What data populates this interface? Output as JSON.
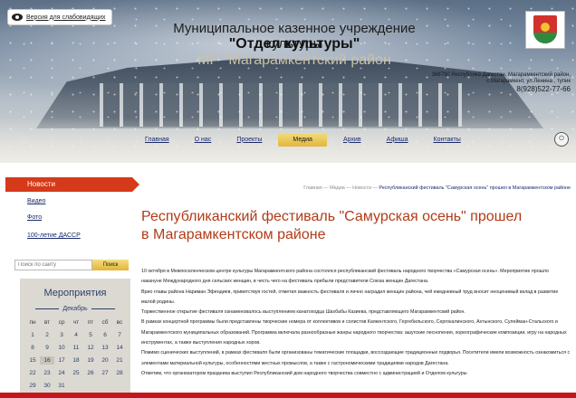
{
  "header": {
    "vi_link": "Версия для слабовидящих",
    "title_line1": "Муниципальное казенное учреждение культуры",
    "title_line2": "\"Отдел культуры\"",
    "title_line3": "МР \"Магарамкентский район",
    "address": "368780 Республика Дагестан, Магарамкентский район, с.Магарамкент, ул.Ленина , тупик",
    "phone": "8(928)522-77-66"
  },
  "nav": {
    "items": [
      {
        "label": "Главная",
        "active": false
      },
      {
        "label": "О нас",
        "active": false
      },
      {
        "label": "Проекты",
        "active": false
      },
      {
        "label": "Медиа",
        "active": true
      },
      {
        "label": "Архив",
        "active": false
      },
      {
        "label": "Афиша",
        "active": false
      },
      {
        "label": "Контакты",
        "active": false
      }
    ]
  },
  "sidebar": {
    "active_item": "Новости",
    "items": [
      "Видео",
      "Фото",
      "100-летие ДАССР"
    ]
  },
  "search": {
    "placeholder": "Поиск по сайту",
    "button": "Поиск"
  },
  "events": {
    "title": "Мероприятия",
    "month": "Декабрь",
    "weekdays": [
      "пн",
      "вт",
      "ср",
      "чт",
      "пт",
      "сб",
      "вс"
    ],
    "weeks": [
      [
        "1",
        "2",
        "3",
        "4",
        "5",
        "6",
        "7"
      ],
      [
        "8",
        "9",
        "10",
        "11",
        "12",
        "13",
        "14"
      ],
      [
        "15",
        "16",
        "17",
        "18",
        "19",
        "20",
        "21"
      ],
      [
        "22",
        "23",
        "24",
        "25",
        "26",
        "27",
        "28"
      ],
      [
        "29",
        "30",
        "31",
        "",
        "",
        "",
        ""
      ]
    ],
    "today": "16"
  },
  "breadcrumb": {
    "items": [
      "Главная",
      "Медиа",
      "Новости"
    ],
    "current": "Республиканский фестиваль \"Самурская осень\" прошел в Магарамкентском районе",
    "separator": "—"
  },
  "article": {
    "title": "Республиканский фестиваль \"Самурская осень\" прошел в Магарамкентском районе",
    "paragraphs": [
      "10 октября в Межпоселенческом центре культуры Магарамкентского района состоялся республиканский фестиваль народного творчества «Самурская осень». Мероприятие прошло накануне Международного дня сельских женщин, в честь чего на фестиваль прибыли представители Союза женщин Дагестана.",
      "Врио главы района Нариман Эфендиев, приветствуя гостей, отметил важность фестиваля и лично наградил женщин района, чей ежедневный труд вносит неоценимый вклад в развитие малой родины.",
      "Торжественное открытие фестиваля ознаменовалось выступлением канатоходца Шахбабы Казиева, представляющего Магарамкентский район.",
      "В рамках концертной программы были представлены творческие номера от коллективов и солистов Каякентского, Гергебильского, Сергокалинского, Ахтынского, Сулейман-Стальского и Магарамкентского муниципальных образований. Программа включала разнообразные жанры народного творчества: ашугские песнопения, хореографические композиции, игру на народных инструментах, а также выступления народных хоров.",
      "Помимо сценических выступлений, в рамках фестиваля были организованы тематические площадки, воссоздающие традиционные подворья. Посетители имели возможность ознакомиться с элементами материальной культуры, особенностями жестных промыслов, а также с гастрономическими традициями народов Дагестана.",
      "Отметим, что организатором праздника выступил Республиканский дом народного творчества совместно с администрацией и Отделом культуры"
    ]
  },
  "colors": {
    "accent_red": "#d53a1a",
    "title_red": "#b23b17",
    "link_blue": "#1a2a6c",
    "nav_active_gold": "#e3b53c"
  }
}
